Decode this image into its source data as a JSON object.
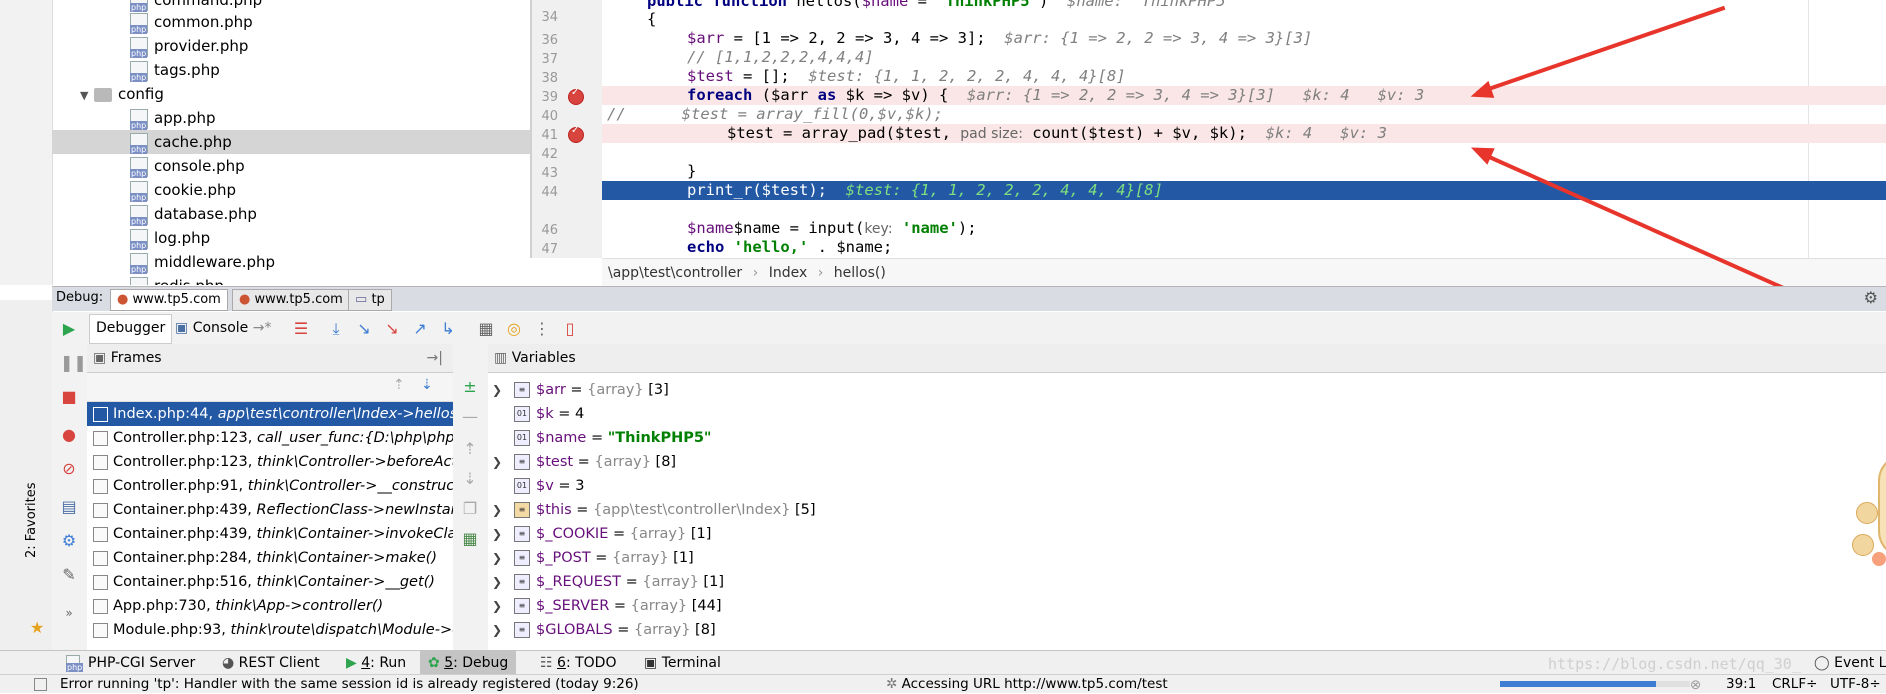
{
  "project_tree": {
    "items": [
      {
        "label": "command.php",
        "type": "file"
      },
      {
        "label": "common.php",
        "type": "file"
      },
      {
        "label": "provider.php",
        "type": "file"
      },
      {
        "label": "tags.php",
        "type": "file"
      },
      {
        "label": "config",
        "type": "folder"
      },
      {
        "label": "app.php",
        "type": "file"
      },
      {
        "label": "cache.php",
        "type": "file",
        "selected": true
      },
      {
        "label": "console.php",
        "type": "file"
      },
      {
        "label": "cookie.php",
        "type": "file"
      },
      {
        "label": "database.php",
        "type": "file"
      },
      {
        "label": "log.php",
        "type": "file"
      },
      {
        "label": "middleware.php",
        "type": "file"
      },
      {
        "label": "redis.php",
        "type": "file"
      }
    ]
  },
  "editor": {
    "line_numbers": [
      "34",
      "36",
      "37",
      "38",
      "39",
      "40",
      "41",
      "42",
      "43",
      "44",
      "46",
      "47"
    ],
    "line34": {
      "kw": "public function",
      "name": " hellos(",
      "param": "$name",
      "eq": " = ",
      "str": "'ThinkPHP5'",
      "close": ")",
      "hint": "$name: \"ThinkPHP5\""
    },
    "line35": "{",
    "line36": {
      "code_var": "$arr",
      "code": " = [1 => 2, 2 => 3, 4 => 3];",
      "hint": "$arr: {1 => 2, 2 => 3, 4 => 3}[3]"
    },
    "line37": "// [1,1,2,2,2,4,4,4]",
    "line38": {
      "code_var": "$test",
      "code": " = [];",
      "hint": "$test: {1, 1, 2, 2, 2, 4, 4, 4}[8]"
    },
    "line39": {
      "kw": "foreach",
      "code": " ($arr ",
      "as": "as",
      "code2": " $k => $v) {",
      "hint": "$arr: {1 => 2, 2 => 3, 4 => 3}[3]   $k: 4   $v: 3"
    },
    "line40": "//      $test = array_fill(0,$v,$k);",
    "line41": {
      "code": "$test = array_pad($test, ",
      "param_hint": "pad size:",
      "code2": " count($test) + $v, $k);",
      "hint": "$k: 4   $v: 3"
    },
    "line43": "}",
    "line44": {
      "code": "print_r($test);",
      "hint": "$test: {1, 1, 2, 2, 2, 4, 4, 4}[8]"
    },
    "line46": {
      "code": "$name = input(",
      "param_hint": "key:",
      "str": "'name'",
      "code2": ");"
    },
    "line47": {
      "kw": "echo",
      "str": "'hello,'",
      "code": " . $name;"
    },
    "breadcrumb": [
      "\\app\\test\\controller",
      "Index",
      "hellos()"
    ]
  },
  "debug": {
    "label": "Debug:",
    "tabs": [
      "www.tp5.com",
      "www.tp5.com",
      "tp"
    ],
    "subtabs": [
      "Debugger",
      "Console"
    ],
    "frames_title": "Frames",
    "variables_title": "Variables",
    "frames": [
      {
        "file": "Index.php:44, ",
        "call": "app\\test\\controller\\Index->hellos()",
        "selected": true
      },
      {
        "file": "Controller.php:123, ",
        "call": "call_user_func:{D:\\php\\php\\thi"
      },
      {
        "file": "Controller.php:123, ",
        "call": "think\\Controller->beforeAction"
      },
      {
        "file": "Controller.php:91, ",
        "call": "think\\Controller->__construct()"
      },
      {
        "file": "Container.php:439, ",
        "call": "ReflectionClass->newInstanceA"
      },
      {
        "file": "Container.php:439, ",
        "call": "think\\Container->invokeClass()"
      },
      {
        "file": "Container.php:284, ",
        "call": "think\\Container->make()"
      },
      {
        "file": "Container.php:516, ",
        "call": "think\\Container->__get()"
      },
      {
        "file": "App.php:730, ",
        "call": "think\\App->controller()"
      },
      {
        "file": "Module.php:93, ",
        "call": "think\\route\\dispatch\\Module->ex"
      }
    ],
    "variables": [
      {
        "name": "$arr",
        "eq": " = ",
        "type": "{array}",
        "value": " [3]",
        "expandable": true
      },
      {
        "name": "$k",
        "eq": " = ",
        "type": "",
        "value": "4",
        "expandable": false
      },
      {
        "name": "$name",
        "eq": " = ",
        "type": "",
        "value": "\"ThinkPHP5\"",
        "expandable": false,
        "string": true
      },
      {
        "name": "$test",
        "eq": " = ",
        "type": "{array}",
        "value": " [8]",
        "expandable": true
      },
      {
        "name": "$v",
        "eq": " = ",
        "type": "",
        "value": "3",
        "expandable": false
      },
      {
        "name": "$this",
        "eq": " = ",
        "type": "{app\\test\\controller\\Index}",
        "value": " [5]",
        "expandable": true
      },
      {
        "name": "$_COOKIE",
        "eq": " = ",
        "type": "{array}",
        "value": " [1]",
        "expandable": true
      },
      {
        "name": "$_POST",
        "eq": " = ",
        "type": "{array}",
        "value": " [1]",
        "expandable": true
      },
      {
        "name": "$_REQUEST",
        "eq": " = ",
        "type": "{array}",
        "value": " [1]",
        "expandable": true
      },
      {
        "name": "$_SERVER",
        "eq": " = ",
        "type": "{array}",
        "value": " [44]",
        "expandable": true
      },
      {
        "name": "$GLOBALS",
        "eq": " = ",
        "type": "{array}",
        "value": " [8]",
        "expandable": true
      }
    ]
  },
  "tool_windows": [
    {
      "num": "",
      "label": "PHP-CGI Server"
    },
    {
      "num": "",
      "label": "REST Client"
    },
    {
      "num": "4",
      "label": ": Run"
    },
    {
      "num": "5",
      "label": ": Debug",
      "active": true
    },
    {
      "num": "6",
      "label": ": TODO"
    },
    {
      "num": "",
      "label": "Terminal"
    },
    {
      "num": "",
      "label": "Event L"
    }
  ],
  "favorites_label": "2: Favorites",
  "status": {
    "message": "Error running 'tp': Handler with the same session id is already registered (today 9:26)",
    "url": "Accessing URL http://www.tp5.com/test",
    "position": "39:1",
    "line_sep": "CRLF÷",
    "encoding": "UTF-8÷"
  },
  "watermark": "https://blog.csdn.net/qq_30_"
}
